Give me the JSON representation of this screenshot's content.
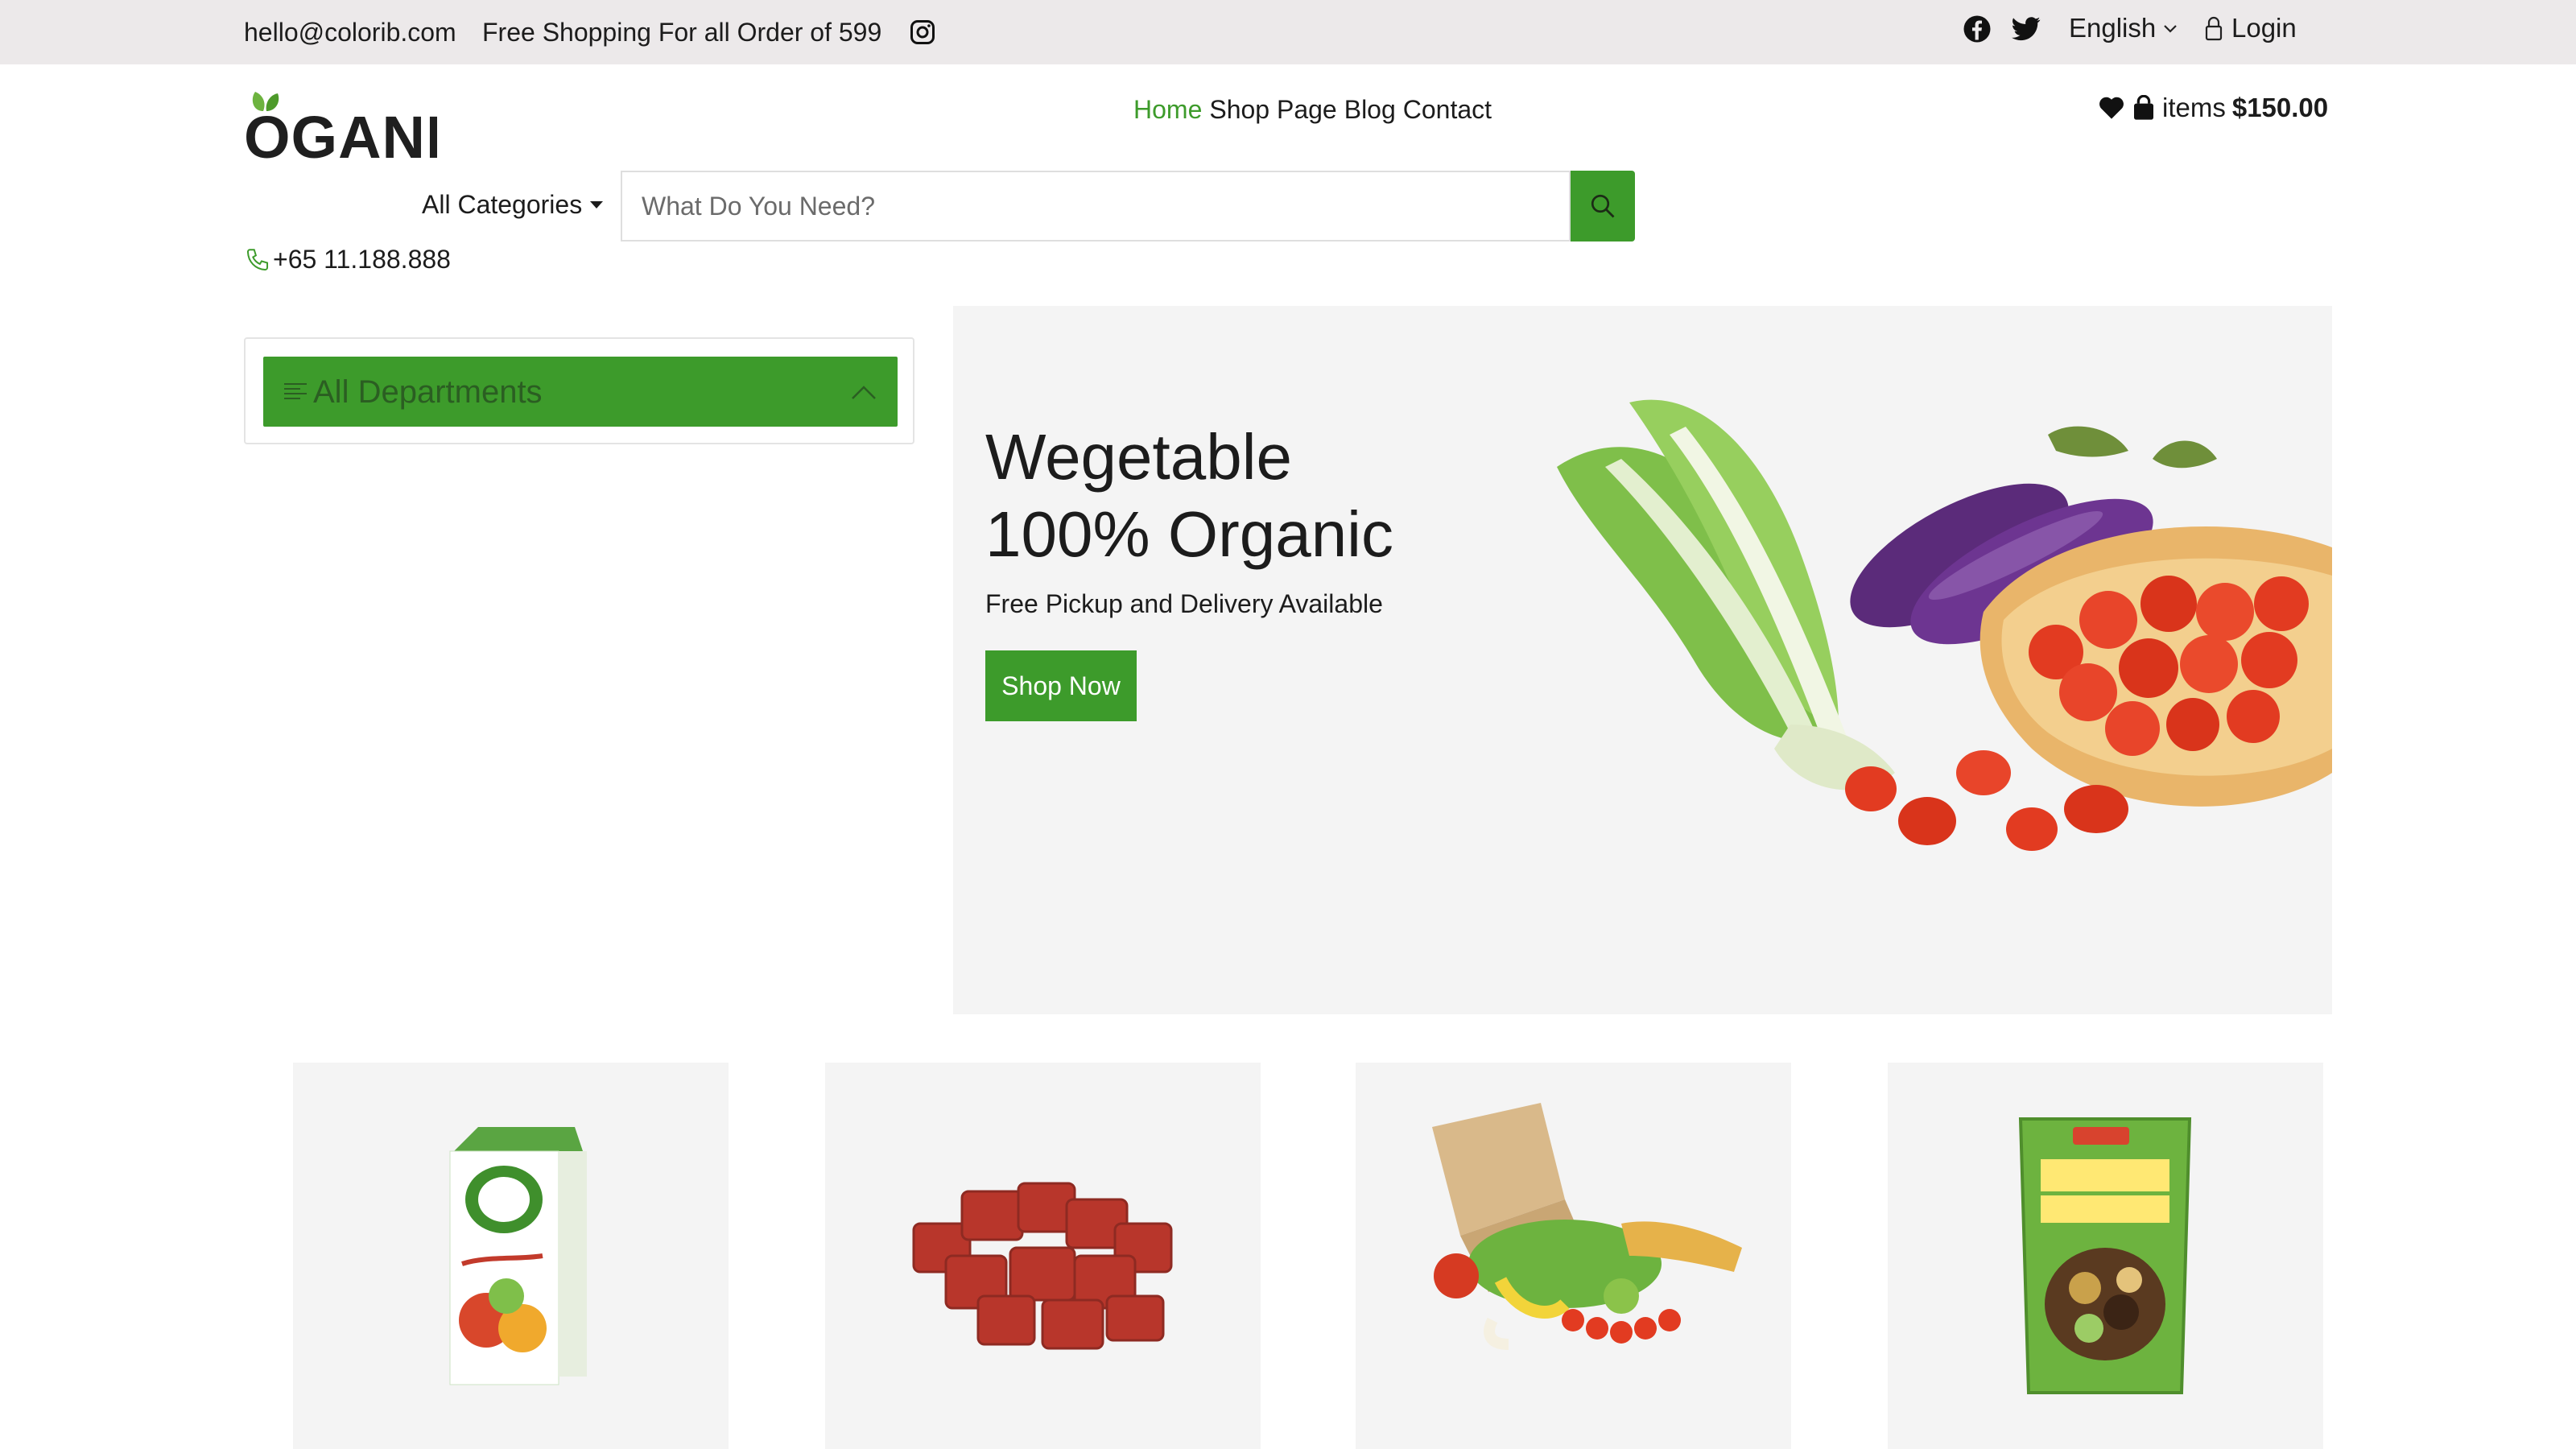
{
  "topbar": {
    "email": "hello@colorib.com",
    "promo": "Free Shopping For all Order of 599",
    "language": "English",
    "login": "Login",
    "icons": [
      "instagram-icon",
      "facebook-icon",
      "twitter-icon",
      "chevron-down-icon",
      "lock-icon"
    ]
  },
  "header": {
    "logo_text": "OGANI",
    "nav": [
      "Home",
      "Shop Page",
      "Blog",
      "Contact"
    ],
    "active_nav": "Home",
    "cart_label": "items",
    "cart_total": "$150.00"
  },
  "search": {
    "category_label": "All Categories",
    "placeholder": "What Do You Need?",
    "phone": "+65 11.188.888"
  },
  "departments": {
    "label": "All Departments"
  },
  "hero": {
    "title_line1": "Wegetable",
    "title_line2": "100% Organic",
    "subtitle": "Free Pickup and Delivery Available",
    "button": "Shop Now"
  },
  "colors": {
    "accent": "#3d9b2b",
    "topbar_bg": "#ece9ea",
    "tile_bg": "#f4f4f4"
  }
}
